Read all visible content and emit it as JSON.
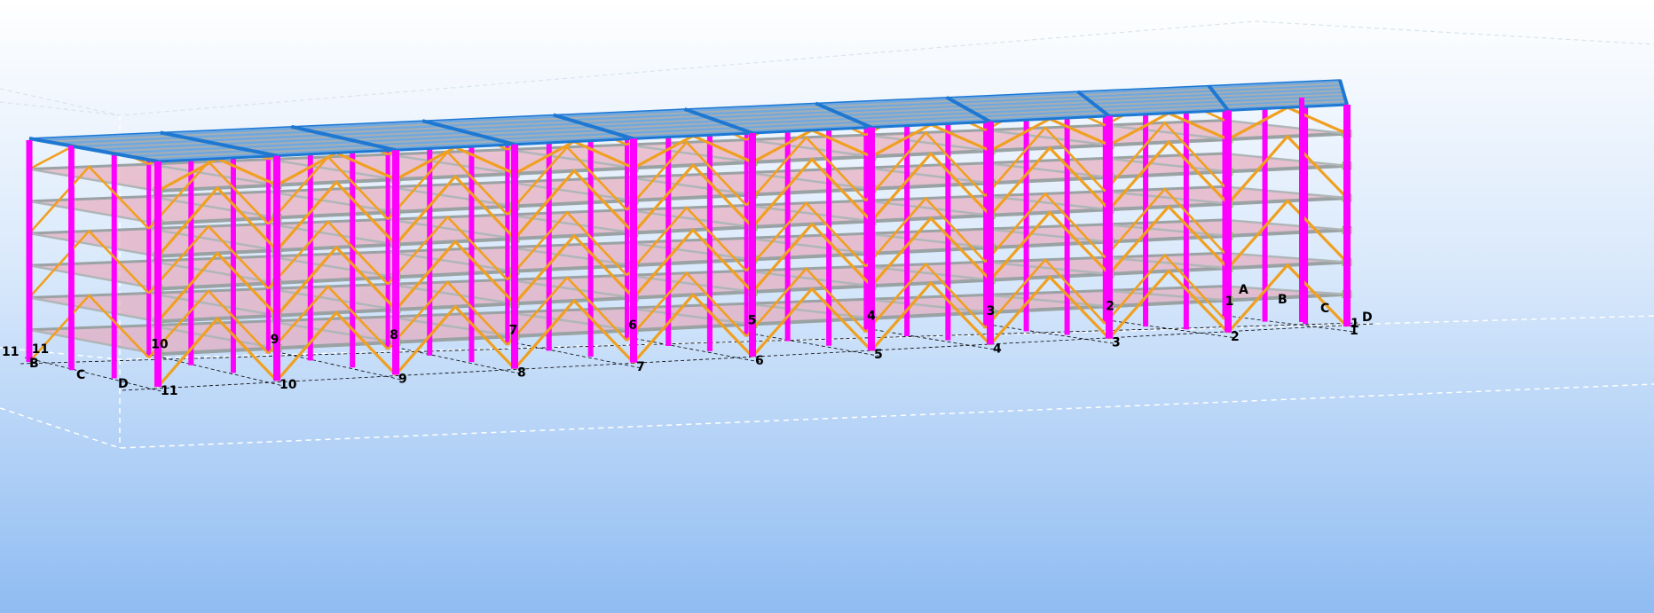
{
  "view": {
    "background_top": "#ffffff",
    "background_bottom": "#8fbcf2",
    "colors": {
      "column": "#ff00ff",
      "bracing": "#f0a020",
      "slab": "#e8a3b4",
      "deck": "#6fa8e0",
      "deck_edge": "#1e78d2",
      "beam": "#9aa2a4",
      "grid_line": "#000000",
      "connection": "#b9e28c"
    }
  },
  "grid": {
    "front_axis_labels": [
      "11",
      "10",
      "9",
      "8",
      "7",
      "6",
      "5",
      "4",
      "3",
      "2",
      "1"
    ],
    "right_end_labels": [
      "A",
      "B",
      "C",
      "D"
    ],
    "left_end_labels": [
      "B",
      "C",
      "D"
    ],
    "end_marker_right": "1",
    "end_marker_left": "11"
  },
  "structure": {
    "bays": 10,
    "floors": 6
  }
}
